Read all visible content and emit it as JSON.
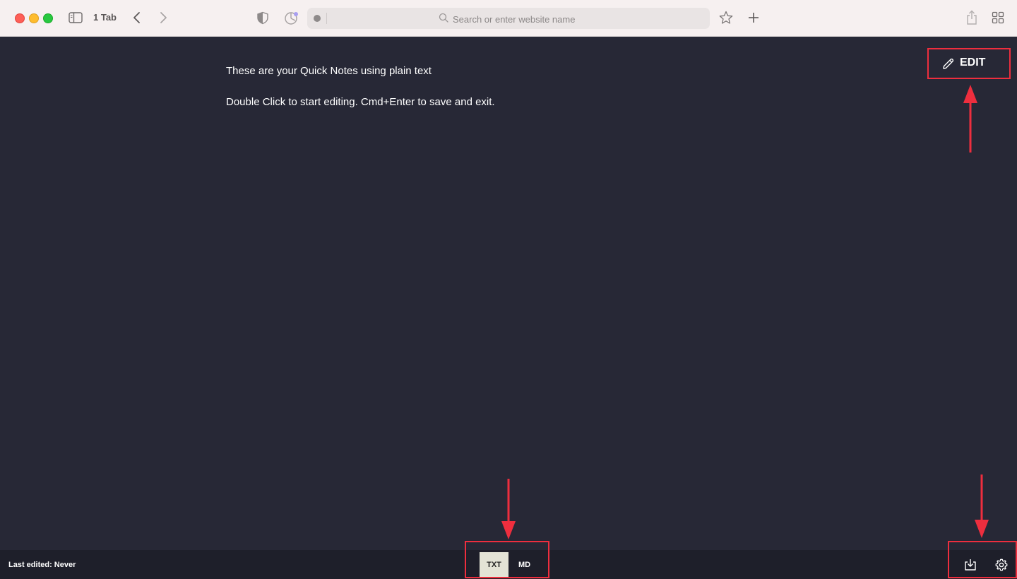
{
  "browser": {
    "tab_count_label": "1 Tab",
    "address_placeholder": "Search or enter website name"
  },
  "note": {
    "lines": [
      "These are your Quick Notes using plain text",
      "Double Click to start editing. Cmd+Enter to save and exit."
    ],
    "edit_label": "EDIT"
  },
  "footer": {
    "last_edited": "Last edited: Never",
    "formats": [
      "TXT",
      "MD"
    ],
    "selected_format": "TXT"
  },
  "colors": {
    "background": "#272836",
    "footer_background": "#1e1f2a",
    "selected_format_bg": "#e3e3d6",
    "annotation": "#ee2e3e"
  },
  "icons": [
    "sidebar-icon",
    "back-icon",
    "forward-icon",
    "shield-icon",
    "privacy-report-icon",
    "search-icon",
    "star-icon",
    "plus-icon",
    "share-icon",
    "tab-overview-icon",
    "pencil-icon",
    "download-icon",
    "gear-icon"
  ]
}
